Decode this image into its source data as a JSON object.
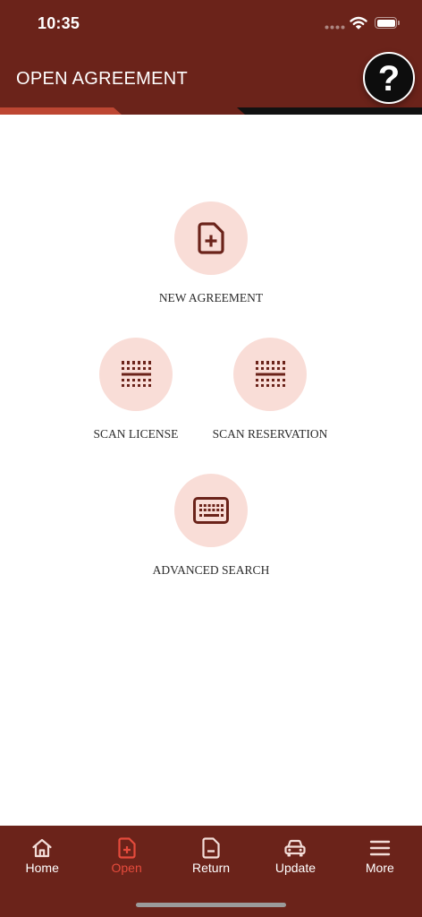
{
  "status_bar": {
    "time": "10:35",
    "battery_level": 1,
    "icons": {
      "signal": "signal-dots-icon",
      "wifi": "wifi-icon",
      "battery": "battery-icon"
    }
  },
  "header": {
    "title": "OPEN AGREEMENT",
    "help_label": "?",
    "help_icon": "help-icon"
  },
  "actions": {
    "new_agreement": {
      "label": "NEW AGREEMENT",
      "icon": "file-plus-icon"
    },
    "scan_license": {
      "label": "SCAN LICENSE",
      "icon": "barcode-scan-icon"
    },
    "scan_reservation": {
      "label": "SCAN RESERVATION",
      "icon": "barcode-scan-icon"
    },
    "advanced_search": {
      "label": "ADVANCED SEARCH",
      "icon": "keyboard-icon"
    }
  },
  "tab_bar": {
    "tabs": [
      {
        "label": "Home",
        "icon": "home-icon",
        "active": false
      },
      {
        "label": "Open",
        "icon": "file-plus-icon",
        "active": true
      },
      {
        "label": "Return",
        "icon": "file-minus-icon",
        "active": false
      },
      {
        "label": "Update",
        "icon": "car-icon",
        "active": false
      },
      {
        "label": "More",
        "icon": "menu-icon",
        "active": false
      }
    ]
  },
  "colors": {
    "primary": "#6b231a",
    "accent": "#e64b3c",
    "circle_bg": "#f9ddd7",
    "stripe": "#bd4632",
    "label_text": "#2b2b2b",
    "tab_icon": "#f3ddd8"
  }
}
